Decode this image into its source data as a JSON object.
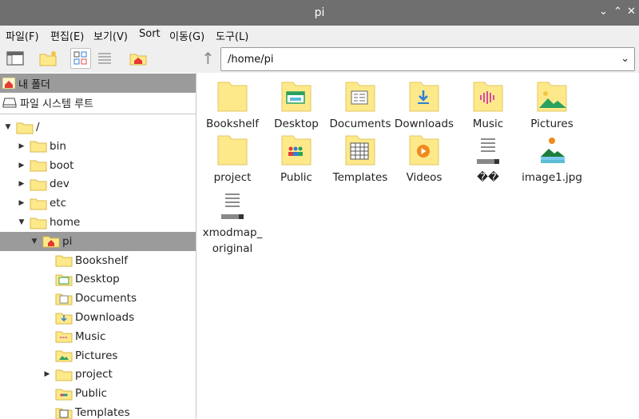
{
  "window": {
    "title": "pi"
  },
  "menu": [
    "파일(F)",
    "편집(E)",
    "보기(V)",
    "Sort",
    "이동(G)",
    "도구(L)"
  ],
  "path": {
    "value": "/home/pi"
  },
  "places": [
    {
      "label": "내 폴더",
      "icon": "home-icon"
    },
    {
      "label": "파일 시스템 루트",
      "icon": "drive-icon"
    }
  ],
  "tree": [
    {
      "label": "/",
      "depth": 0,
      "expander": "open"
    },
    {
      "label": "bin",
      "depth": 1,
      "expander": "closed"
    },
    {
      "label": "boot",
      "depth": 1,
      "expander": "closed"
    },
    {
      "label": "dev",
      "depth": 1,
      "expander": "closed"
    },
    {
      "label": "etc",
      "depth": 1,
      "expander": "closed"
    },
    {
      "label": "home",
      "depth": 1,
      "expander": "open"
    },
    {
      "label": "pi",
      "depth": 2,
      "expander": "open"
    },
    {
      "label": "Bookshelf",
      "depth": 3,
      "expander": "none"
    },
    {
      "label": "Desktop",
      "depth": 3,
      "expander": "none"
    },
    {
      "label": "Documents",
      "depth": 3,
      "expander": "none"
    },
    {
      "label": "Downloads",
      "depth": 3,
      "expander": "none"
    },
    {
      "label": "Music",
      "depth": 3,
      "expander": "none"
    },
    {
      "label": "Pictures",
      "depth": 3,
      "expander": "none"
    },
    {
      "label": "project",
      "depth": 3,
      "expander": "closed"
    },
    {
      "label": "Public",
      "depth": 3,
      "expander": "none"
    },
    {
      "label": "Templates",
      "depth": 3,
      "expander": "none"
    }
  ],
  "files": [
    {
      "name": "Bookshelf",
      "type": "folder"
    },
    {
      "name": "Desktop",
      "type": "folder-desktop"
    },
    {
      "name": "Documents",
      "type": "folder-documents"
    },
    {
      "name": "Downloads",
      "type": "folder-downloads"
    },
    {
      "name": "Music",
      "type": "folder-music"
    },
    {
      "name": "Pictures",
      "type": "folder-pictures"
    },
    {
      "name": "project",
      "type": "folder"
    },
    {
      "name": "Public",
      "type": "folder-public"
    },
    {
      "name": "Templates",
      "type": "folder-templates"
    },
    {
      "name": "Videos",
      "type": "folder-videos"
    },
    {
      "name": "��᠎",
      "type": "text-file"
    },
    {
      "name": "image1.jpg",
      "type": "image-file"
    },
    {
      "name": "xmodmap_",
      "name2": "original",
      "type": "text-file"
    }
  ],
  "colors": {
    "folder": "#fde98a",
    "selection": "#9b9b9b",
    "titlebar": "#6f6f6f"
  }
}
